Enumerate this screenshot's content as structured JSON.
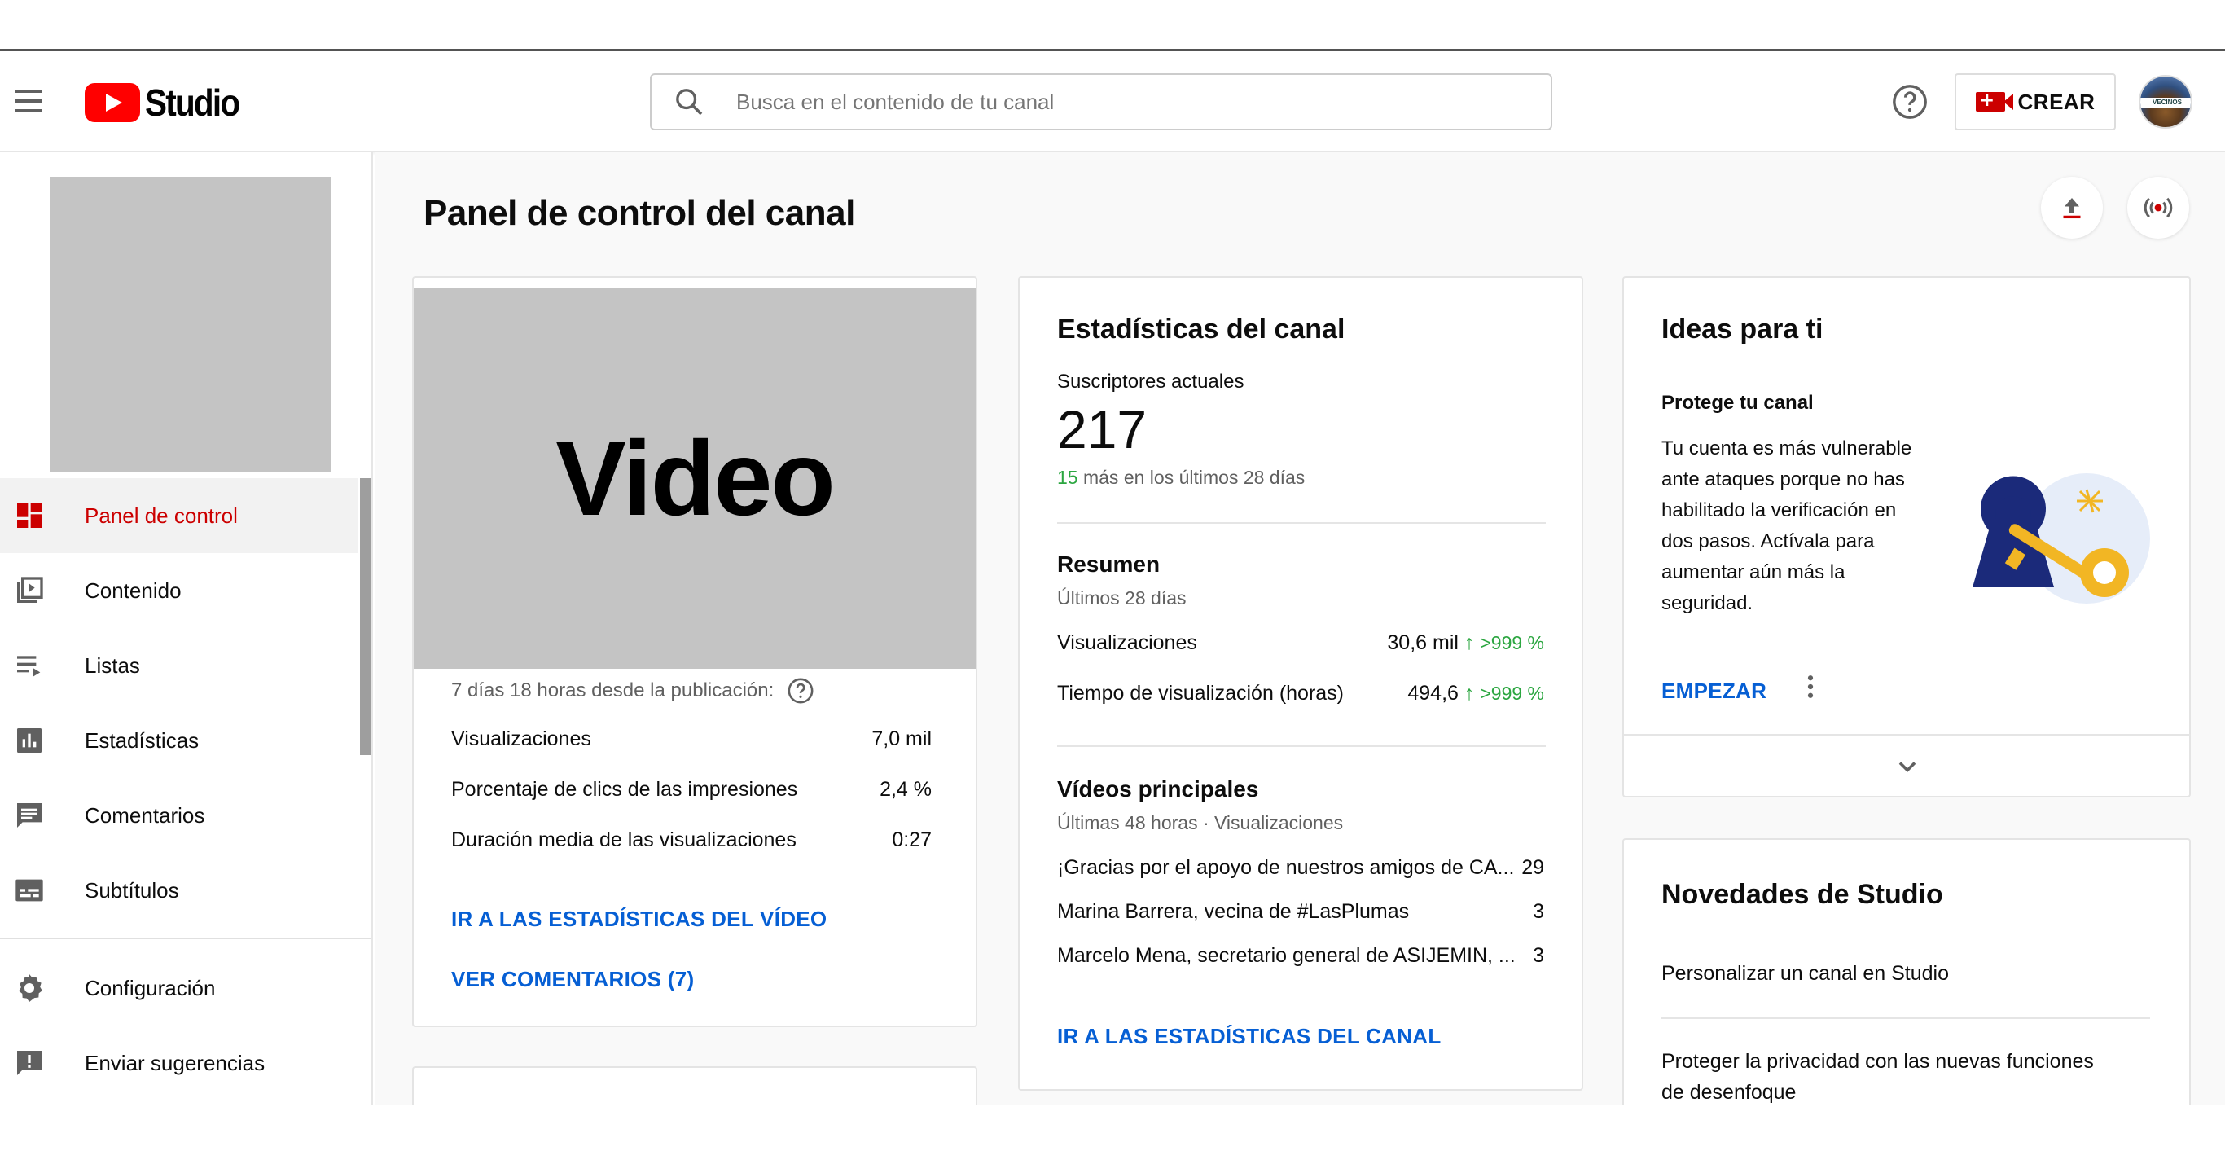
{
  "header": {
    "logo_text": "Studio",
    "search_placeholder": "Busca en el contenido de tu canal",
    "create_label": "CREAR",
    "avatar_text": "VECINOS"
  },
  "sidebar": {
    "items": [
      {
        "label": "Panel de control",
        "icon": "dashboard-icon",
        "active": true
      },
      {
        "label": "Contenido",
        "icon": "video-library-icon"
      },
      {
        "label": "Listas",
        "icon": "playlist-icon"
      },
      {
        "label": "Estadísticas",
        "icon": "analytics-icon"
      },
      {
        "label": "Comentarios",
        "icon": "comment-icon"
      },
      {
        "label": "Subtítulos",
        "icon": "subtitles-icon"
      },
      {
        "label": "Configuración",
        "icon": "gear-icon"
      },
      {
        "label": "Enviar sugerencias",
        "icon": "feedback-icon"
      }
    ]
  },
  "page": {
    "title": "Panel de control del canal"
  },
  "video_card": {
    "thumb_label": "Video",
    "since": "7 días 18 horas desde la publicación:",
    "metrics": [
      {
        "label": "Visualizaciones",
        "value": "7,0 mil"
      },
      {
        "label": "Porcentaje de clics de las impresiones",
        "value": "2,4 %"
      },
      {
        "label": "Duración media de las visualizaciones",
        "value": "0:27"
      }
    ],
    "link_stats": "IR A LAS ESTADÍSTICAS DEL VÍDEO",
    "link_comments": "VER COMENTARIOS (7)"
  },
  "stats_card": {
    "title": "Estadísticas del canal",
    "subs_label": "Suscriptores actuales",
    "subs_value": "217",
    "delta_number": "15",
    "delta_text": " más en los últimos 28 días",
    "summary_title": "Resumen",
    "summary_sub": "Últimos 28 días",
    "summary": [
      {
        "label": "Visualizaciones",
        "value": "30,6 mil",
        "trend": ">999 %"
      },
      {
        "label": "Tiempo de visualización (horas)",
        "value": "494,6",
        "trend": ">999 %"
      }
    ],
    "top_title": "Vídeos principales",
    "top_sub": "Últimas 48 horas · Visualizaciones",
    "top_videos": [
      {
        "title": "¡Gracias por el apoyo de nuestros amigos de CA...",
        "views": "29"
      },
      {
        "title": "Marina Barrera, vecina de #LasPlumas",
        "views": "3"
      },
      {
        "title": "Marcelo Mena, secretario general de ASIJEMIN, ...",
        "views": "3"
      }
    ],
    "link": "IR A LAS ESTADÍSTICAS DEL CANAL"
  },
  "ideas_card": {
    "title": "Ideas para ti",
    "subtitle": "Protege tu canal",
    "body_lines": [
      "Tu cuenta es más vulnerable",
      "ante ataques porque no has",
      "habilitado la verificación en",
      "dos pasos. Actívala para",
      "aumentar aún más la",
      "seguridad."
    ],
    "cta": "EMPEZAR"
  },
  "news_card": {
    "title": "Novedades de Studio",
    "items": [
      "Personalizar un canal en Studio",
      "Proteger la privacidad con las nuevas funciones",
      "de desenfoque"
    ]
  },
  "colors": {
    "brand_red": "#ff0000",
    "active_red": "#cc0000",
    "link_blue": "#065fd4",
    "trend_green": "#2ba640"
  }
}
